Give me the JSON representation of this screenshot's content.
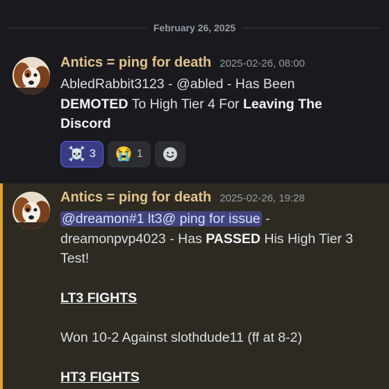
{
  "date_divider": "February 26, 2025",
  "messages": [
    {
      "username": "Antics = ping for death",
      "timestamp": "2025-02-26, 08:00",
      "line1": "AbledRabbit3123 - @abled - Has Been",
      "demoted": "DEMOTED",
      "to_tier": " To High Tier 4 For ",
      "leaving": "Leaving The",
      "discord": "Discord",
      "reactions": [
        {
          "emoji": "☠️",
          "count": "3",
          "active": true
        },
        {
          "emoji": "😭",
          "count": "1",
          "active": false
        }
      ],
      "add_reaction_icon": "smiley-add-reaction-icon"
    },
    {
      "username": "Antics = ping for death",
      "timestamp": "2025-02-26, 19:28",
      "mention": "@dreamon#1 lt3@ ping for issue",
      "after_mention": " -",
      "line2_pre": "dreamonpvp4023 - Has ",
      "passed": "PASSED",
      "line2_post": " His High Tier 3",
      "line3": "Test!",
      "lt3_heading": "LT3 FIGHTS",
      "lt3_result": "Won 10-2 Against slothdude11 (ff at 8-2)",
      "ht3_heading": "HT3 FIGHTS"
    }
  ],
  "colors": {
    "username": "#e3c38c",
    "highlight_bar": "#e4a327",
    "mention_bg": "#5865f2"
  }
}
